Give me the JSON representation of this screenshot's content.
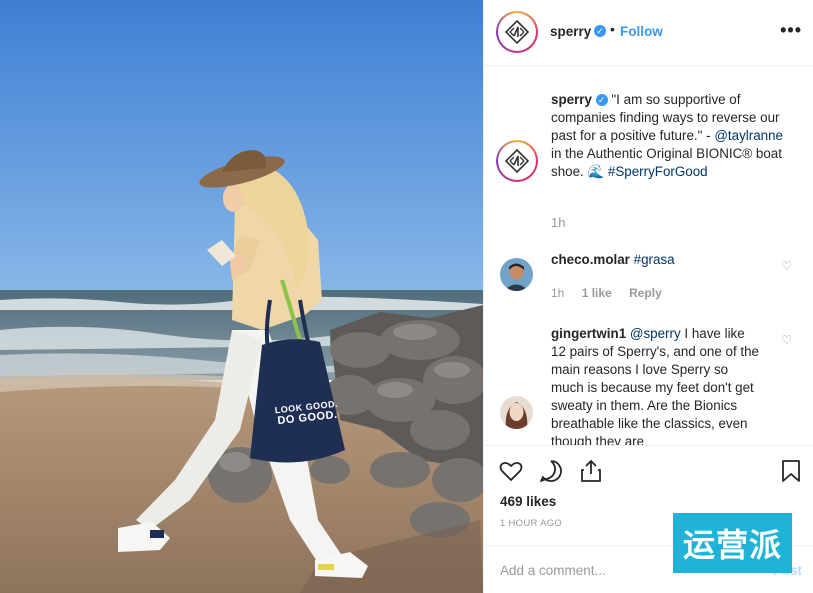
{
  "header": {
    "username": "sperry",
    "follow_label": "Follow",
    "more_label": "•••",
    "separator": "•"
  },
  "photo": {
    "bag_text_line1": "LOOK GOOD.",
    "bag_text_line2": "DO GOOD."
  },
  "caption": {
    "username": "sperry",
    "text_before_mention": "\"I am so supportive of companies finding ways to reverse our past for a positive future.\" -",
    "mention": "@taylranne",
    "text_after_mention": "in the Authentic Original BIONIC® boat shoe. 🌊",
    "hashtag": "#SperryForGood",
    "time": "1h"
  },
  "comments": [
    {
      "username": "checo.molar",
      "hashtag": "#grasa",
      "time": "1h",
      "likes": "1 like",
      "reply_label": "Reply"
    },
    {
      "username": "gingertwin1",
      "mention": "@sperry",
      "text": "I have like 12 pairs of Sperry's, and one of the main reasons I love Sperry so much is because my feet don't get sweaty in them. Are the Bionics breathable like the classics, even though they are"
    }
  ],
  "actions": {
    "likes_count": "469 likes",
    "time_ago": "1 HOUR AGO"
  },
  "add_comment": {
    "placeholder": "Add a comment...",
    "post_label": "Post"
  },
  "watermark": {
    "text": "运营派"
  },
  "colors": {
    "link_blue": "#3897f0",
    "mention_blue": "#003569",
    "muted": "#999999",
    "watermark_bg": "#1fb3d8"
  }
}
